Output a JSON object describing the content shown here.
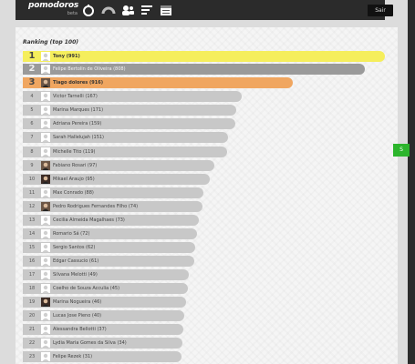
{
  "header": {
    "logo_main": "pomodoros",
    "logo_sub": "beta",
    "exit_label": "Sair"
  },
  "ranking": {
    "title": "Ranking (top 100)",
    "rows": [
      {
        "rank": "1",
        "name": "Tony (991)"
      },
      {
        "rank": "2",
        "name": "Felipe Bertolin de Oliveira (808)"
      },
      {
        "rank": "3",
        "name": "Tiago dolores (916)"
      },
      {
        "rank": "4",
        "name": "Victor Tarnelli (167)"
      },
      {
        "rank": "5",
        "name": "Marina Marques (171)"
      },
      {
        "rank": "6",
        "name": "Adriana Pereira (159)"
      },
      {
        "rank": "7",
        "name": "Sarah Hallelujah (151)"
      },
      {
        "rank": "8",
        "name": "Michelle Tito (119)"
      },
      {
        "rank": "9",
        "name": "Fabiano Rosari (97)"
      },
      {
        "rank": "10",
        "name": "Mikael Araujo (95)"
      },
      {
        "rank": "11",
        "name": "Max Conrado (88)"
      },
      {
        "rank": "12",
        "name": "Pedro Rodrigues Fernandes Filho (74)"
      },
      {
        "rank": "13",
        "name": "Cecilia Almeida Magalhaes (73)"
      },
      {
        "rank": "14",
        "name": "Romario Sá (72)"
      },
      {
        "rank": "15",
        "name": "Sergio Santos (62)"
      },
      {
        "rank": "16",
        "name": "Edgar Cassucio (61)"
      },
      {
        "rank": "17",
        "name": "Silvana Melotti (49)"
      },
      {
        "rank": "18",
        "name": "Coelho de Souza Acculia (45)"
      },
      {
        "rank": "19",
        "name": "Marina Nogueira (46)"
      },
      {
        "rank": "20",
        "name": "Lucas Jose Pieno (40)"
      },
      {
        "rank": "21",
        "name": "Alessandra Bellotti (37)"
      },
      {
        "rank": "22",
        "name": "Lydia Maria Gomes da Silva (34)"
      },
      {
        "rank": "23",
        "name": "Felipe Rezek (31)"
      }
    ]
  },
  "side_tab": {
    "label": "S"
  },
  "colors": {
    "gold": "#f5ee5c",
    "silver": "#9a9a9a",
    "bronze": "#f0a660",
    "bar": "#c8c8c8"
  },
  "icons": [
    "timer-icon",
    "stats-icon",
    "users-icon",
    "list-icon",
    "calendar-icon"
  ]
}
